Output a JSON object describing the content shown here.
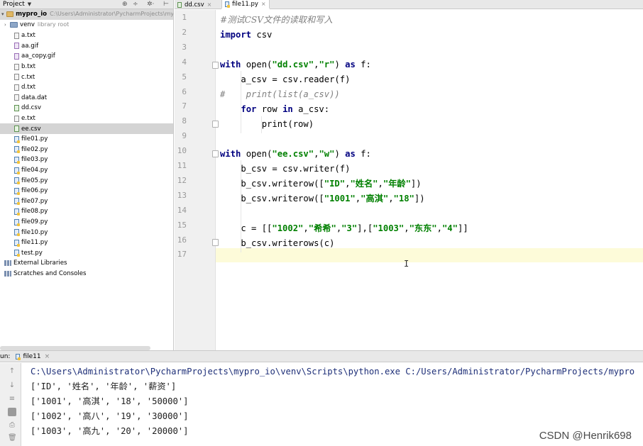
{
  "project_panel": {
    "title": "Project",
    "root": {
      "name": "mypro_io",
      "path": "C:\\Users\\Administrator\\PycharmProjects\\my"
    },
    "venv": {
      "name": "venv",
      "tag": "library root"
    },
    "files": [
      "a.txt",
      "aa.gif",
      "aa_copy.gif",
      "b.txt",
      "c.txt",
      "d.txt",
      "data.dat",
      "dd.csv",
      "e.txt",
      "ee.csv",
      "file01.py",
      "file02.py",
      "file03.py",
      "file04.py",
      "file05.py",
      "file06.py",
      "file07.py",
      "file08.py",
      "file09.py",
      "file10.py",
      "file11.py",
      "test.py"
    ],
    "selected_file": "ee.csv",
    "external_libraries": "External Libraries",
    "scratches": "Scratches and Consoles"
  },
  "editor": {
    "tabs": [
      {
        "label": "dd.csv",
        "active": false
      },
      {
        "label": "file11.py",
        "active": true
      }
    ],
    "line_numbers": [
      "1",
      "2",
      "3",
      "4",
      "5",
      "6",
      "7",
      "8",
      "9",
      "10",
      "11",
      "12",
      "13",
      "14",
      "15",
      "16",
      "17"
    ],
    "code": {
      "l1": "#测试CSV文件的读取和写入",
      "l2_kw": "import",
      "l2_rest": " csv",
      "l4_kw": "with",
      "l4_a": " open(",
      "l4_s1": "\"dd.csv\"",
      "l4_b": ",",
      "l4_s2": "\"r\"",
      "l4_c": ") ",
      "l4_kw2": "as",
      "l4_d": " f:",
      "l5": "    a_csv = csv.reader(f)",
      "l6": "#    print(list(a_csv))",
      "l7_a": "    ",
      "l7_kw": "for",
      "l7_b": " row ",
      "l7_kw2": "in",
      "l7_c": " a_csv:",
      "l8": "        print(row)",
      "l10_kw": "with",
      "l10_a": " open(",
      "l10_s1": "\"ee.csv\"",
      "l10_b": ",",
      "l10_s2": "\"w\"",
      "l10_c": ") ",
      "l10_kw2": "as",
      "l10_d": " f:",
      "l11": "    b_csv = csv.writer(f)",
      "l12_a": "    b_csv.writerow([",
      "l12_s1": "\"ID\"",
      "l12_b": ",",
      "l12_s2": "\"姓名\"",
      "l12_c": ",",
      "l12_s3": "\"年龄\"",
      "l12_d": "])",
      "l13_a": "    b_csv.writerow([",
      "l13_s1": "\"1001\"",
      "l13_b": ",",
      "l13_s2": "\"高淇\"",
      "l13_c": ",",
      "l13_s3": "\"18\"",
      "l13_d": "])",
      "l15_a": "    c = [[",
      "l15_s1": "\"1002\"",
      "l15_b": ",",
      "l15_s2": "\"希希\"",
      "l15_c": ",",
      "l15_s3": "\"3\"",
      "l15_d": "],[",
      "l15_s4": "\"1003\"",
      "l15_e": ",",
      "l15_s5": "\"东东\"",
      "l15_f": ",",
      "l15_s6": "\"4\"",
      "l15_g": "]]",
      "l16": "    b_csv.writerows(c)"
    },
    "current_line": "17"
  },
  "run_panel": {
    "label": "un:",
    "tab": "file11",
    "output": [
      "C:\\Users\\Administrator\\PycharmProjects\\mypro_io\\venv\\Scripts\\python.exe C:/Users/Administrator/PycharmProjects/mypro",
      "['ID', '姓名', '年龄', '薪资']",
      "['1001', '高淇', '18', '50000']",
      "['1002', '高八', '19', '30000']",
      "['1003', '高九', '20', '20000']"
    ]
  },
  "watermark": "CSDN @Henrik698",
  "colors": {
    "keyword": "#000080",
    "string": "#008000",
    "comment": "#808080",
    "current_line": "#fdfbd9"
  }
}
